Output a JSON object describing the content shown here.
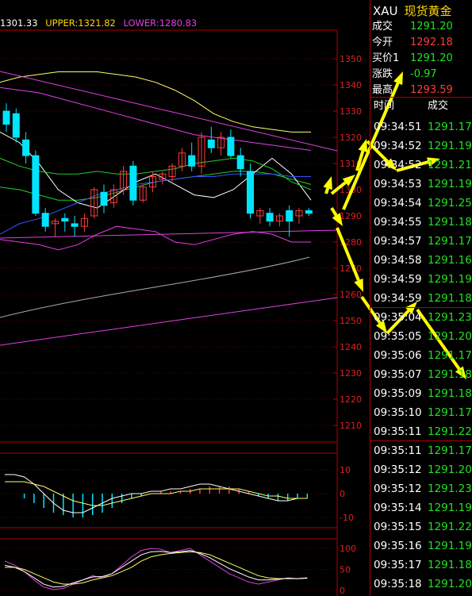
{
  "indicator": {
    "mid": "1301.33",
    "upper": "UPPER:1321.82",
    "lower": "LOWER:1280.83"
  },
  "colors": {
    "up": "#ff3b3b",
    "down": "#22e022",
    "candle_up": "#ff3b3b",
    "candle_down": "#00e5ff",
    "grid": "#b00000",
    "axis_text": "#e02020",
    "arrow": "#ffff00",
    "ma1": "#ffff66",
    "ma2": "#ffffff",
    "ma3": "#22d022",
    "ma4": "#3355ff",
    "boll": "#e040e0",
    "trend": "#e040e0",
    "long_ma": "#aaaaaa"
  },
  "price_axis": [
    "1350",
    "1340",
    "1330",
    "1320",
    "1310",
    "1300",
    "1290",
    "1280",
    "1270",
    "1260",
    "1250",
    "1240",
    "1230",
    "1220",
    "1210"
  ],
  "macd_axis": [
    "10",
    "0",
    "-10"
  ],
  "kdj_axis": [
    "100",
    "50",
    "0"
  ],
  "symbol": {
    "code": "XAU",
    "name": "现货黄金"
  },
  "quote": [
    {
      "label": "成交",
      "value": "1291.20",
      "color": "#22e022"
    },
    {
      "label": "今开",
      "value": "1292.18",
      "color": "#ff3b3b"
    },
    {
      "label": "买价1",
      "value": "1291.20",
      "color": "#22e022"
    },
    {
      "label": "涨跌",
      "value": "-0.97",
      "color": "#22e022"
    },
    {
      "label": "最高",
      "value": "1293.59",
      "color": "#ff3b3b"
    }
  ],
  "trades_header": {
    "time": "时间",
    "price": "成交"
  },
  "trades": [
    {
      "time": "09:34:51",
      "price": "1291.17",
      "color": "#22e022"
    },
    {
      "time": "09:34:52",
      "price": "1291.19",
      "color": "#22e022"
    },
    {
      "time": "09:34:52",
      "price": "1291.21",
      "color": "#22e022"
    },
    {
      "time": "09:34:53",
      "price": "1291.19",
      "color": "#22e022"
    },
    {
      "time": "09:34:54",
      "price": "1291.25",
      "color": "#22e022"
    },
    {
      "time": "09:34:55",
      "price": "1291.18",
      "color": "#22e022"
    },
    {
      "time": "09:34:57",
      "price": "1291.17",
      "color": "#22e022"
    },
    {
      "time": "09:34:58",
      "price": "1291.16",
      "color": "#22e022"
    },
    {
      "time": "09:34:59",
      "price": "1291.19",
      "color": "#22e022"
    },
    {
      "time": "09:34:59",
      "price": "1291.18",
      "color": "#22e022"
    },
    {
      "time": "09:35:04",
      "price": "1291.23",
      "color": "#22e022"
    },
    {
      "time": "09:35:05",
      "price": "1291.20",
      "color": "#22e022"
    },
    {
      "time": "09:35:06",
      "price": "1291.17",
      "color": "#22e022"
    },
    {
      "time": "09:35:07",
      "price": "1291.18",
      "color": "#22e022"
    },
    {
      "time": "09:35:09",
      "price": "1291.18",
      "color": "#22e022"
    },
    {
      "time": "09:35:10",
      "price": "1291.17",
      "color": "#22e022"
    },
    {
      "time": "09:35:11",
      "price": "1291.22",
      "color": "#22e022"
    },
    {
      "time": "09:35:11",
      "price": "1291.17",
      "color": "#22e022"
    },
    {
      "time": "09:35:12",
      "price": "1291.20",
      "color": "#22e022"
    },
    {
      "time": "09:35:12",
      "price": "1291.23",
      "color": "#22e022"
    },
    {
      "time": "09:35:14",
      "price": "1291.19",
      "color": "#22e022"
    },
    {
      "time": "09:35:15",
      "price": "1291.22",
      "color": "#22e022"
    },
    {
      "time": "09:35:16",
      "price": "1291.19",
      "color": "#22e022"
    },
    {
      "time": "09:35:17",
      "price": "1291.18",
      "color": "#22e022"
    },
    {
      "time": "09:35:18",
      "price": "1291.20",
      "color": "#22e022"
    }
  ],
  "candles": [
    {
      "o": 1330,
      "h": 1333,
      "l": 1322,
      "c": 1325
    },
    {
      "o": 1329,
      "h": 1331,
      "l": 1318,
      "c": 1320
    },
    {
      "o": 1319,
      "h": 1322,
      "l": 1310,
      "c": 1313
    },
    {
      "o": 1313,
      "h": 1315,
      "l": 1290,
      "c": 1291
    },
    {
      "o": 1291,
      "h": 1293,
      "l": 1284,
      "c": 1286
    },
    {
      "o": 1287,
      "h": 1289,
      "l": 1282,
      "c": 1288
    },
    {
      "o": 1289,
      "h": 1291,
      "l": 1284,
      "c": 1288
    },
    {
      "o": 1287,
      "h": 1290,
      "l": 1282,
      "c": 1286
    },
    {
      "o": 1286,
      "h": 1291,
      "l": 1284,
      "c": 1289
    },
    {
      "o": 1290,
      "h": 1301,
      "l": 1289,
      "c": 1300
    },
    {
      "o": 1299,
      "h": 1302,
      "l": 1291,
      "c": 1294
    },
    {
      "o": 1295,
      "h": 1302,
      "l": 1293,
      "c": 1300
    },
    {
      "o": 1300,
      "h": 1309,
      "l": 1298,
      "c": 1307
    },
    {
      "o": 1309,
      "h": 1311,
      "l": 1294,
      "c": 1296
    },
    {
      "o": 1296,
      "h": 1302,
      "l": 1295,
      "c": 1301
    },
    {
      "o": 1301,
      "h": 1307,
      "l": 1299,
      "c": 1305
    },
    {
      "o": 1304,
      "h": 1307,
      "l": 1302,
      "c": 1306
    },
    {
      "o": 1305,
      "h": 1310,
      "l": 1303,
      "c": 1309
    },
    {
      "o": 1309,
      "h": 1316,
      "l": 1307,
      "c": 1314
    },
    {
      "o": 1313,
      "h": 1318,
      "l": 1307,
      "c": 1309
    },
    {
      "o": 1309,
      "h": 1322,
      "l": 1306,
      "c": 1320
    },
    {
      "o": 1319,
      "h": 1324,
      "l": 1314,
      "c": 1316
    },
    {
      "o": 1316,
      "h": 1322,
      "l": 1313,
      "c": 1320
    },
    {
      "o": 1320,
      "h": 1323,
      "l": 1312,
      "c": 1313
    },
    {
      "o": 1313,
      "h": 1316,
      "l": 1305,
      "c": 1308
    },
    {
      "o": 1307,
      "h": 1310,
      "l": 1289,
      "c": 1291
    },
    {
      "o": 1290,
      "h": 1293,
      "l": 1287,
      "c": 1292
    },
    {
      "o": 1291,
      "h": 1293,
      "l": 1286,
      "c": 1288
    },
    {
      "o": 1288,
      "h": 1291,
      "l": 1286,
      "c": 1290
    },
    {
      "o": 1292,
      "h": 1294,
      "l": 1282,
      "c": 1288
    },
    {
      "o": 1290,
      "h": 1293,
      "l": 1287,
      "c": 1292
    },
    {
      "o": 1292,
      "h": 1293,
      "l": 1290,
      "c": 1291
    }
  ],
  "ma_lines": {
    "ma1": [
      1341,
      1343,
      1344,
      1345,
      1345,
      1345,
      1344,
      1343,
      1341,
      1338,
      1334,
      1329,
      1326,
      1324,
      1323,
      1322,
      1322
    ],
    "ma2": [
      1322,
      1318,
      1310,
      1300,
      1295,
      1293,
      1298,
      1303,
      1306,
      1302,
      1298,
      1297,
      1300,
      1306,
      1312,
      1306,
      1296
    ],
    "ma3": [
      1312,
      1309,
      1307,
      1306,
      1306,
      1307,
      1306,
      1306,
      1307,
      1308,
      1310,
      1311,
      1312,
      1311,
      1308,
      1303,
      1300
    ],
    "ma4": [
      1283,
      1287,
      1289,
      1292,
      1295,
      1298,
      1300,
      1302,
      1303,
      1304,
      1305,
      1305,
      1306,
      1306,
      1306,
      1305,
      1305
    ],
    "boll_up": [
      1339,
      1338,
      1337,
      1335,
      1333,
      1331,
      1329,
      1327,
      1325,
      1323,
      1321,
      1320,
      1319,
      1318,
      1317,
      1316,
      1315
    ],
    "boll_mid": [
      1301,
      1300,
      1298,
      1296,
      1296,
      1297,
      1299,
      1301,
      1303,
      1304,
      1305,
      1306,
      1307,
      1307,
      1306,
      1304,
      1302
    ],
    "boll_low": [
      1281,
      1280,
      1279,
      1277,
      1279,
      1283,
      1286,
      1285,
      1284,
      1280,
      1279,
      1281,
      1283,
      1284,
      1283,
      1280,
      1280
    ]
  }
}
